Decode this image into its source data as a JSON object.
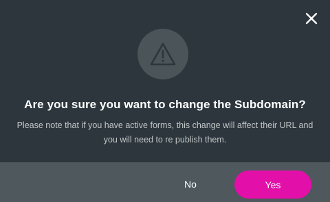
{
  "dialog": {
    "title": "Are you sure you want to change the Subdomain?",
    "message": "Please note that if you have active forms, this change will affect their URL and you will need to re publish them.",
    "icons": {
      "close": "close-icon",
      "warning": "warning-icon"
    },
    "buttons": {
      "no_label": "No",
      "yes_label": "Yes"
    }
  },
  "colors": {
    "background": "#2c363c",
    "footer": "#4f585d",
    "accent": "#e20fa8",
    "icon_circle": "#4b5458"
  }
}
